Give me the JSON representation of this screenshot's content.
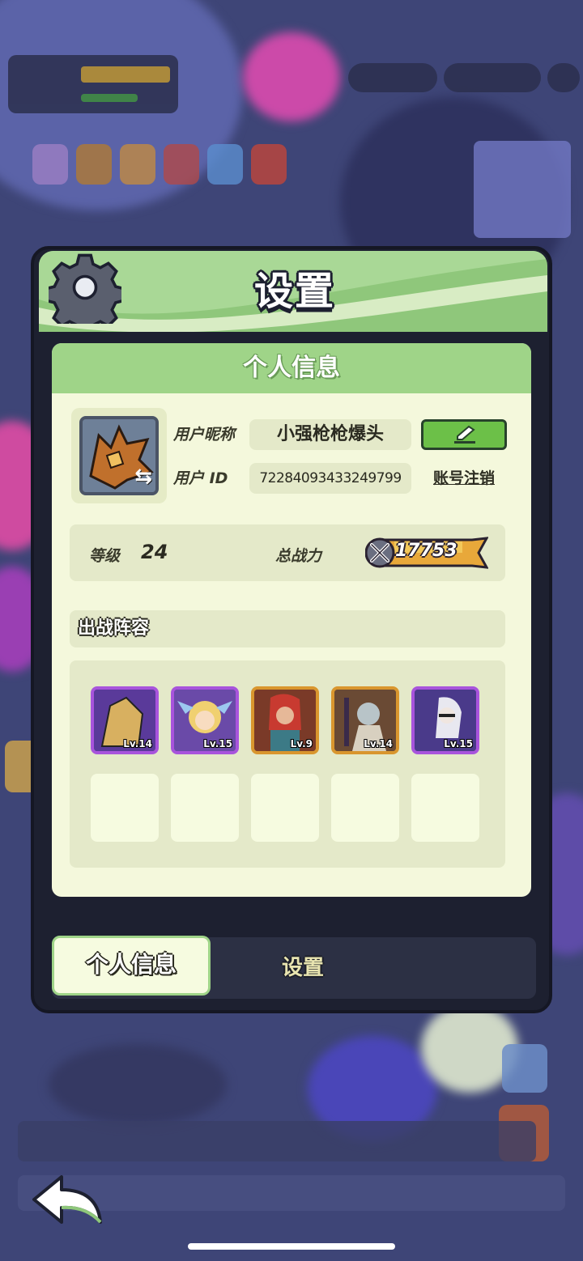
{
  "dialog": {
    "title": "设置"
  },
  "profile": {
    "section_title": "个人信息",
    "nickname_label": "用户昵称",
    "nickname": "小强枪枪爆头",
    "id_label": "用户 ID",
    "user_id": "72284093433249799",
    "cancel_account": "账号注销"
  },
  "stats": {
    "level_label": "等级",
    "level": "24",
    "power_label": "总战力",
    "power": "17753"
  },
  "lineup": {
    "title": "出战阵容",
    "heroes": [
      {
        "level": "Lv.14",
        "rarity": "purple"
      },
      {
        "level": "Lv.15",
        "rarity": "purple"
      },
      {
        "level": "Lv.9",
        "rarity": "gold"
      },
      {
        "level": "Lv.14",
        "rarity": "gold"
      },
      {
        "level": "Lv.15",
        "rarity": "purple"
      }
    ]
  },
  "tabs": {
    "profile": "个人信息",
    "settings": "设置"
  },
  "icons": [
    "gear-icon",
    "swap-icon",
    "edit-icon",
    "sword-icon",
    "back-arrow-icon"
  ],
  "colors": {
    "header_green": "#8fc77b",
    "panel_bg": "#f4f8dc",
    "edit_green": "#6cc048",
    "purple_frame": "#a854dc",
    "gold_frame": "#d9962e"
  }
}
